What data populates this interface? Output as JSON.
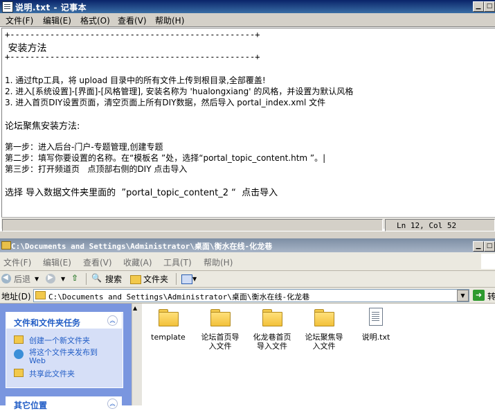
{
  "notepad": {
    "title": "说明.txt - 记事本",
    "menu": [
      "文件(F)",
      "编辑(E)",
      "格式(O)",
      "查看(V)",
      "帮助(H)"
    ],
    "lines": [
      "+-------------------------------------------------+",
      " 安装方法",
      "+-------------------------------------------------+",
      "",
      "1. 通过ftp工具，将 upload 目录中的所有文件上传到根目录,全部覆盖!",
      "2. 进入[系统设置]-[界面]-[风格管理], 安装名称为 'hualongxiang' 的风格，并设置为默认风格",
      "3. 进入首页DIY设置页面，清空页面上所有DIY数据，然后导入 portal_index.xml 文件",
      "",
      "论坛聚焦安装方法:",
      "",
      "第一步：进入后台-门户-专题管理,创建专题",
      "第二步：填写你要设置的名称。在“模板名 ”处，选择“portal_topic_content.htm ”。|",
      "第三步：打开频道页   点顶部右侧的DIY 点击导入",
      "",
      "选择 导入数据文件夹里面的  ”portal_topic_content_2 “  点击导入"
    ],
    "status_position": "Ln 12, Col 52"
  },
  "explorer": {
    "title": "C:\\Documents and Settings\\Administrator\\桌面\\衡水在线-化龙巷",
    "menu": [
      "文件(F)",
      "编辑(E)",
      "查看(V)",
      "收藏(A)",
      "工具(T)",
      "帮助(H)"
    ],
    "toolbar": {
      "back_label": "后退",
      "search_label": "搜索",
      "folders_label": "文件夹"
    },
    "address": {
      "label": "地址(D)",
      "value": "C:\\Documents and Settings\\Administrator\\桌面\\衡水在线-化龙巷",
      "go_label": "转"
    },
    "tasks": {
      "title": "文件和文件夹任务",
      "items": [
        "创建一个新文件夹",
        "将这个文件夹发布到\nWeb",
        "共享此文件夹"
      ],
      "other_title": "其它位置"
    },
    "files": [
      {
        "name": "template",
        "type": "folder"
      },
      {
        "name": "论坛首页导\n入文件",
        "type": "folder"
      },
      {
        "name": "化龙巷首页\n导入文件",
        "type": "folder"
      },
      {
        "name": "论坛聚焦导\n入文件",
        "type": "folder"
      },
      {
        "name": "说明.txt",
        "type": "text"
      }
    ]
  }
}
